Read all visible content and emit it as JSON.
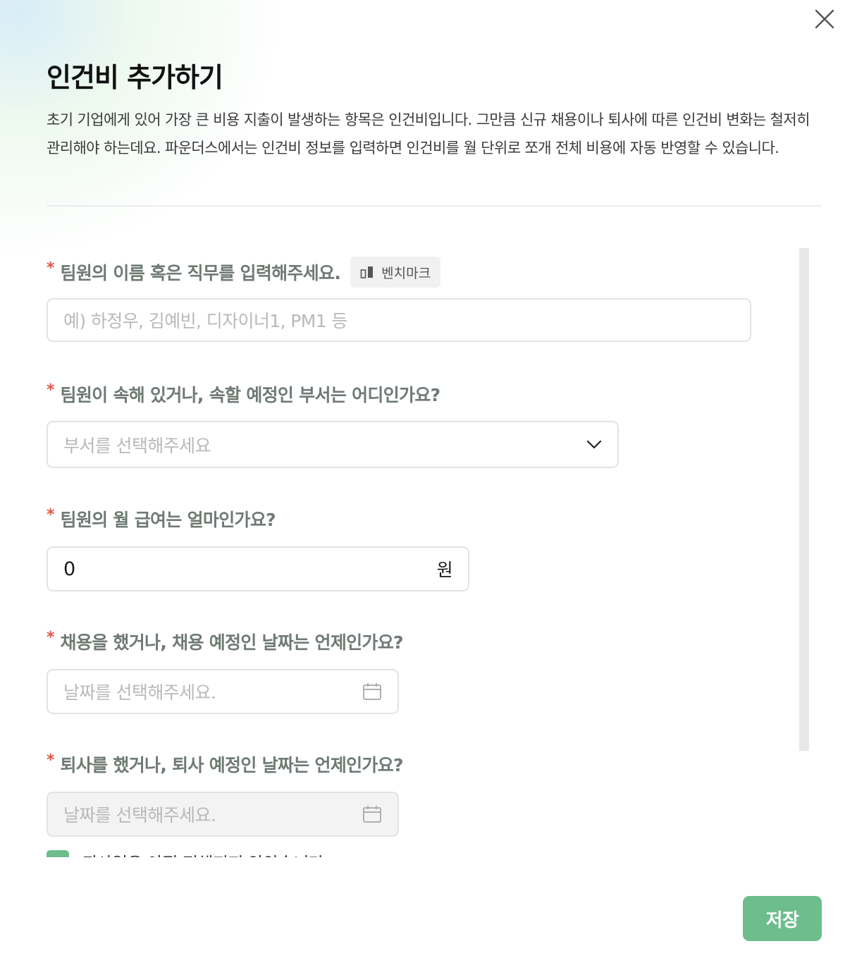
{
  "modal": {
    "title": "인건비 추가하기",
    "description": "초기 기업에게 있어 가장 큰 비용 지출이 발생하는 항목은 인건비입니다. 그만큼 신규 채용이나 퇴사에 따른 인건비 변화는 철저히 관리해야 하는데요. 파운더스에서는 인건비 정보를 입력하면 인건비를 월 단위로 쪼개 전체 비용에 자동 반영할 수 있습니다.",
    "close_icon": "close-icon",
    "save_label": "저장"
  },
  "form": {
    "required_mark": "*",
    "name": {
      "question": "팀원의 이름 혹은 직무를 입력해주세요.",
      "benchmark_label": "벤치마크",
      "benchmark_icon": "bar-chart-icon",
      "placeholder": "예) 하정우, 김예빈, 디자이너1, PM1 등"
    },
    "department": {
      "question": "팀원이 속해 있거나, 속할 예정인 부서는 어디인가요?",
      "placeholder": "부서를 선택해주세요",
      "icon": "chevron-down-icon"
    },
    "salary": {
      "question": "팀원의 월 급여는 얼마인가요?",
      "value": "0",
      "unit": "원"
    },
    "hire_date": {
      "question": "채용을 했거나, 채용 예정인 날짜는 언제인가요?",
      "placeholder": "날짜를 선택해주세요.",
      "icon": "calendar-icon"
    },
    "leave_date": {
      "question": "퇴사를 했거나, 퇴사 예정인 날짜는 언제인가요?",
      "placeholder": "날짜를 선택해주세요.",
      "icon": "calendar-icon",
      "checkbox_label": "퇴사일은 아직 정해지지 않았습니다"
    }
  },
  "colors": {
    "accent": "#6dbd8d",
    "required": "#e0584a",
    "question_text": "#6f7a73"
  }
}
